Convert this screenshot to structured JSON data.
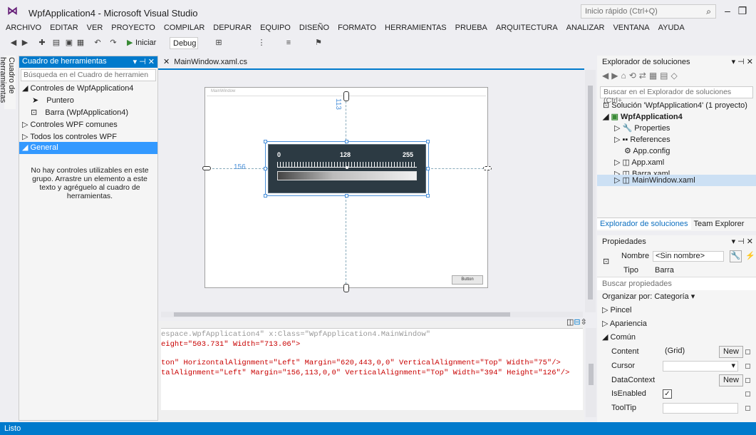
{
  "window": {
    "title": "WpfApplication4 - Microsoft Visual Studio",
    "quick_launch_placeholder": "Inicio rápido (Ctrl+Q)"
  },
  "menu": [
    "ARCHIVO",
    "EDITAR",
    "VER",
    "PROYECTO",
    "COMPILAR",
    "DEPURAR",
    "EQUIPO",
    "DISEÑO",
    "FORMATO",
    "HERRAMIENTAS",
    "PRUEBA",
    "ARQUITECTURA",
    "ANALIZAR",
    "VENTANA",
    "AYUDA"
  ],
  "toolbar": {
    "start_label": "Iniciar",
    "config": "Debug"
  },
  "toolbox": {
    "side_label": "Cuadro de herramientas",
    "title": "Cuadro de herramientas",
    "search_placeholder": "Búsqueda en el Cuadro de herramien",
    "group_wpf_app": "◢ Controles de WpfApplication4",
    "item_pointer": "Puntero",
    "item_barra": "Barra (WpfApplication4)",
    "group_common": "▷ Controles WPF comunes",
    "group_all": "▷ Todos los controles WPF",
    "group_general": "◢ General",
    "empty_message": "No hay controles utilizables en este grupo. Arrastre un elemento a este texto y agréguelo al cuadro de herramientas."
  },
  "document": {
    "tab_label": "MainWindow.xaml.cs",
    "window_caption": "MainWindow",
    "margin_top": "113",
    "margin_left": "156",
    "button_label": "Button",
    "gauge": {
      "min_label": "0",
      "mid_label": "128",
      "max_label": "255",
      "needle_fraction": 0.5
    }
  },
  "xaml": {
    "line1": "espace.WpfApplication4\" x:Class=\"WpfApplication4.MainWindow\"",
    "line2a": "eight=\"503.731\" Width=\"713.06\">",
    "line3a": "ton\" HorizontalAlignment=\"Left\" Margin=\"620,443,0,0\" VerticalAlignment=\"Top\" Width=\"75\"/>",
    "line4a": "talAlignment=\"Left\" Margin=\"156,113,0,0\" VerticalAlignment=\"Top\" Width=\"394\" Height=\"126\"/>"
  },
  "solution_explorer": {
    "title": "Explorador de soluciones",
    "search_placeholder": "Buscar en el Explorador de soluciones (Ctrl+",
    "items": [
      "Solución 'WpfApplication4' (1 proyecto)",
      "WpfApplication4",
      "Properties",
      "References",
      "App.config",
      "App.xaml",
      "Barra.xaml",
      "MainWindow.xaml"
    ],
    "tab_active": "Explorador de soluciones",
    "tab_other": "Team Explorer"
  },
  "properties": {
    "title": "Propiedades",
    "name_label": "Nombre",
    "name_value": "<Sin nombre>",
    "type_label": "Tipo",
    "type_value": "Barra",
    "search_placeholder": "Buscar propiedades",
    "organize": "Organizar por: Categoría ▾",
    "cat_brush": "▷ Pincel",
    "cat_appearance": "▷ Apariencia",
    "cat_common": "◢ Común",
    "rows": [
      {
        "name": "Content",
        "value": "(Grid)",
        "button": "New"
      },
      {
        "name": "Cursor",
        "value": "",
        "button": ""
      },
      {
        "name": "DataContext",
        "value": "",
        "button": "New"
      },
      {
        "name": "IsEnabled",
        "value": "✓",
        "button": ""
      },
      {
        "name": "ToolTip",
        "value": "",
        "button": ""
      }
    ]
  },
  "status": {
    "text": "Listo"
  },
  "colors": {
    "accent": "#007acc",
    "selection": "#3399ff",
    "vs_purple": "#68217a"
  }
}
